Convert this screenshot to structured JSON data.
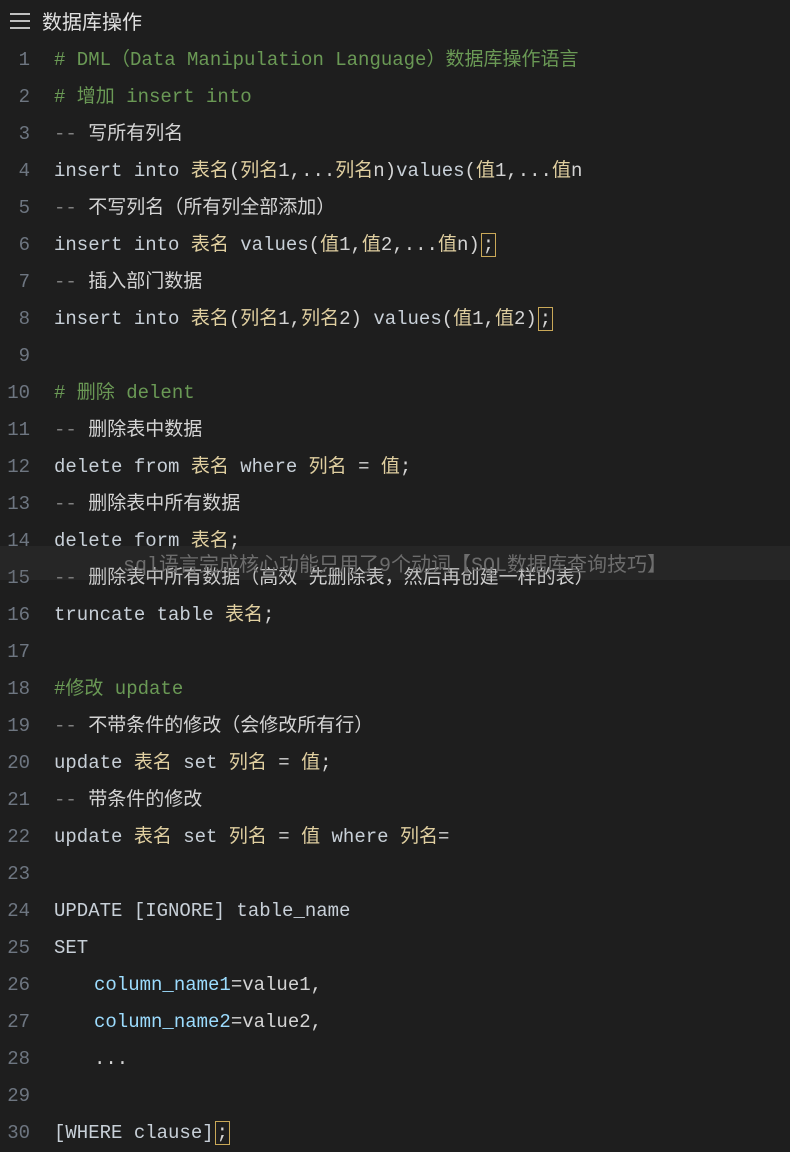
{
  "header": {
    "title": "数据库操作"
  },
  "lines": {
    "1": {
      "num": "1",
      "tokens": [
        {
          "cls": "c-comment",
          "txt": "# DML（Data Manipulation Language）数据库操作语言"
        }
      ]
    },
    "2": {
      "num": "2",
      "tokens": [
        {
          "cls": "c-comment",
          "txt": "# 增加 insert into"
        }
      ]
    },
    "3": {
      "num": "3",
      "tokens": [
        {
          "cls": "c-grey",
          "txt": "-- "
        },
        {
          "cls": "cjk-w",
          "txt": "写所有列名"
        }
      ]
    },
    "4": {
      "num": "4",
      "tokens": [
        {
          "cls": "c-keyword",
          "txt": "insert into "
        },
        {
          "cls": "c-cjk",
          "txt": "表名"
        },
        {
          "cls": "c-punc",
          "txt": "("
        },
        {
          "cls": "c-cjk",
          "txt": "列名"
        },
        {
          "cls": "c-text",
          "txt": "1,..."
        },
        {
          "cls": "c-cjk",
          "txt": "列名"
        },
        {
          "cls": "c-text",
          "txt": "n)"
        },
        {
          "cls": "c-keyword",
          "txt": "values"
        },
        {
          "cls": "c-punc",
          "txt": "("
        },
        {
          "cls": "c-cjk",
          "txt": "值"
        },
        {
          "cls": "c-text",
          "txt": "1,..."
        },
        {
          "cls": "c-cjk",
          "txt": "值"
        },
        {
          "cls": "c-text",
          "txt": "n"
        }
      ]
    },
    "5": {
      "num": "5",
      "tokens": [
        {
          "cls": "c-grey",
          "txt": "-- "
        },
        {
          "cls": "cjk-w",
          "txt": "不写列名（所有列全部添加）"
        }
      ]
    },
    "6": {
      "num": "6",
      "tokens": [
        {
          "cls": "c-keyword",
          "txt": "insert into "
        },
        {
          "cls": "c-cjk",
          "txt": "表名"
        },
        {
          "cls": "c-keyword",
          "txt": " values"
        },
        {
          "cls": "c-punc",
          "txt": "("
        },
        {
          "cls": "c-cjk",
          "txt": "值"
        },
        {
          "cls": "c-text",
          "txt": "1,"
        },
        {
          "cls": "c-cjk",
          "txt": "值"
        },
        {
          "cls": "c-text",
          "txt": "2,..."
        },
        {
          "cls": "c-cjk",
          "txt": "值"
        },
        {
          "cls": "c-text",
          "txt": "n)"
        }
      ],
      "cursor": ";"
    },
    "7": {
      "num": "7",
      "tokens": [
        {
          "cls": "c-grey",
          "txt": "-- "
        },
        {
          "cls": "cjk-w",
          "txt": "插入部门数据"
        }
      ]
    },
    "8": {
      "num": "8",
      "tokens": [
        {
          "cls": "c-keyword",
          "txt": "insert into "
        },
        {
          "cls": "c-cjk",
          "txt": "表名"
        },
        {
          "cls": "c-punc",
          "txt": "("
        },
        {
          "cls": "c-cjk",
          "txt": "列名"
        },
        {
          "cls": "c-text",
          "txt": "1,"
        },
        {
          "cls": "c-cjk",
          "txt": "列名"
        },
        {
          "cls": "c-text",
          "txt": "2) "
        },
        {
          "cls": "c-keyword",
          "txt": "values"
        },
        {
          "cls": "c-punc",
          "txt": "("
        },
        {
          "cls": "c-cjk",
          "txt": "值"
        },
        {
          "cls": "c-text",
          "txt": "1,"
        },
        {
          "cls": "c-cjk",
          "txt": "值"
        },
        {
          "cls": "c-text",
          "txt": "2)"
        }
      ],
      "cursor": ";"
    },
    "9": {
      "num": "9",
      "tokens": []
    },
    "10": {
      "num": "10",
      "tokens": [
        {
          "cls": "c-comment",
          "txt": "# 删除 delent"
        }
      ]
    },
    "11": {
      "num": "11",
      "tokens": [
        {
          "cls": "c-grey",
          "txt": "-- "
        },
        {
          "cls": "cjk-w",
          "txt": "删除表中数据"
        }
      ]
    },
    "12": {
      "num": "12",
      "tokens": [
        {
          "cls": "c-keyword",
          "txt": "delete from "
        },
        {
          "cls": "c-cjk",
          "txt": "表名"
        },
        {
          "cls": "c-keyword",
          "txt": " where "
        },
        {
          "cls": "c-cjk",
          "txt": "列名"
        },
        {
          "cls": "c-text",
          "txt": " = "
        },
        {
          "cls": "c-cjk",
          "txt": "值"
        },
        {
          "cls": "c-text",
          "txt": ";"
        }
      ]
    },
    "13": {
      "num": "13",
      "tokens": [
        {
          "cls": "c-grey",
          "txt": "-- "
        },
        {
          "cls": "cjk-w",
          "txt": "删除表中所有数据"
        }
      ]
    },
    "14": {
      "num": "14",
      "tokens": [
        {
          "cls": "c-keyword",
          "txt": "delete form "
        },
        {
          "cls": "c-cjk",
          "txt": "表名"
        },
        {
          "cls": "c-text",
          "txt": ";"
        }
      ]
    },
    "15": {
      "num": "15",
      "tokens": [
        {
          "cls": "c-grey",
          "txt": "-- "
        },
        {
          "cls": "cjk-w",
          "txt": "删除表中所有数据（高效 先删除表，然后再创建一样的表）"
        }
      ]
    },
    "16": {
      "num": "16",
      "tokens": [
        {
          "cls": "c-keyword",
          "txt": "truncate table "
        },
        {
          "cls": "c-cjk",
          "txt": "表名"
        },
        {
          "cls": "c-text",
          "txt": ";"
        }
      ]
    },
    "17": {
      "num": "17",
      "tokens": []
    },
    "18": {
      "num": "18",
      "tokens": [
        {
          "cls": "c-comment",
          "txt": "#修改 update"
        }
      ]
    },
    "19": {
      "num": "19",
      "tokens": [
        {
          "cls": "c-grey",
          "txt": "-- "
        },
        {
          "cls": "cjk-w",
          "txt": "不带条件的修改（会修改所有行）"
        }
      ]
    },
    "20": {
      "num": "20",
      "tokens": [
        {
          "cls": "c-keyword",
          "txt": "update "
        },
        {
          "cls": "c-cjk",
          "txt": "表名"
        },
        {
          "cls": "c-keyword",
          "txt": " set "
        },
        {
          "cls": "c-cjk",
          "txt": "列名"
        },
        {
          "cls": "c-text",
          "txt": " = "
        },
        {
          "cls": "c-cjk",
          "txt": "值"
        },
        {
          "cls": "c-text",
          "txt": ";"
        }
      ]
    },
    "21": {
      "num": "21",
      "tokens": [
        {
          "cls": "c-grey",
          "txt": "-- "
        },
        {
          "cls": "cjk-w",
          "txt": "带条件的修改"
        }
      ]
    },
    "22": {
      "num": "22",
      "tokens": [
        {
          "cls": "c-keyword",
          "txt": "update "
        },
        {
          "cls": "c-cjk",
          "txt": "表名"
        },
        {
          "cls": "c-keyword",
          "txt": " set "
        },
        {
          "cls": "c-cjk",
          "txt": "列名"
        },
        {
          "cls": "c-text",
          "txt": " = "
        },
        {
          "cls": "c-cjk",
          "txt": "值"
        },
        {
          "cls": "c-keyword",
          "txt": " where "
        },
        {
          "cls": "c-cjk",
          "txt": "列名"
        },
        {
          "cls": "c-text",
          "txt": "="
        }
      ]
    },
    "23": {
      "num": "23",
      "tokens": []
    },
    "24": {
      "num": "24",
      "tokens": [
        {
          "cls": "c-keyword",
          "txt": "UPDATE [IGNORE] table_name"
        }
      ]
    },
    "25": {
      "num": "25",
      "tokens": [
        {
          "cls": "c-keyword",
          "txt": "SET"
        }
      ]
    },
    "26": {
      "num": "26",
      "indent": 1,
      "tokens": [
        {
          "cls": "c-var",
          "txt": "column_name1"
        },
        {
          "cls": "c-text",
          "txt": "=value1,"
        }
      ]
    },
    "27": {
      "num": "27",
      "indent": 1,
      "tokens": [
        {
          "cls": "c-var",
          "txt": "column_name2"
        },
        {
          "cls": "c-text",
          "txt": "=value2,"
        }
      ]
    },
    "28": {
      "num": "28",
      "indent": 1,
      "tokens": [
        {
          "cls": "c-text",
          "txt": "..."
        }
      ]
    },
    "29": {
      "num": "29",
      "tokens": []
    },
    "30": {
      "num": "30",
      "tokens": [
        {
          "cls": "c-keyword",
          "txt": "[WHERE clause]"
        }
      ],
      "cursor": ";"
    }
  },
  "watermark": "sql语言完成核心功能只用了9个动词【SQL数据库查询技巧】"
}
